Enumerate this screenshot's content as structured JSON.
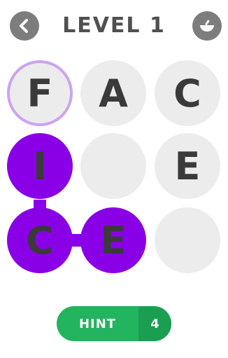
{
  "header": {
    "title": "LEVEL 1",
    "back_icon": "chevron-left-icon",
    "shop_icon": "bowl-icon"
  },
  "grid": {
    "rows": [
      [
        {
          "letter": "F",
          "state": "start"
        },
        {
          "letter": "A",
          "state": "idle"
        },
        {
          "letter": "C",
          "state": "idle"
        }
      ],
      [
        {
          "letter": "I",
          "state": "selected"
        },
        {
          "letter": "",
          "state": "empty"
        },
        {
          "letter": "E",
          "state": "idle"
        }
      ],
      [
        {
          "letter": "C",
          "state": "selected"
        },
        {
          "letter": "E",
          "state": "selected"
        },
        {
          "letter": "",
          "state": "empty"
        }
      ]
    ]
  },
  "hint": {
    "label": "HINT",
    "count": "4"
  },
  "colors": {
    "selected": "#8a00e6",
    "start_ring": "#cda3f0",
    "cell": "#ececec",
    "hint": "#22b45e",
    "hint_dark": "#1a9e51",
    "icon_bg": "#7d7d7d"
  }
}
